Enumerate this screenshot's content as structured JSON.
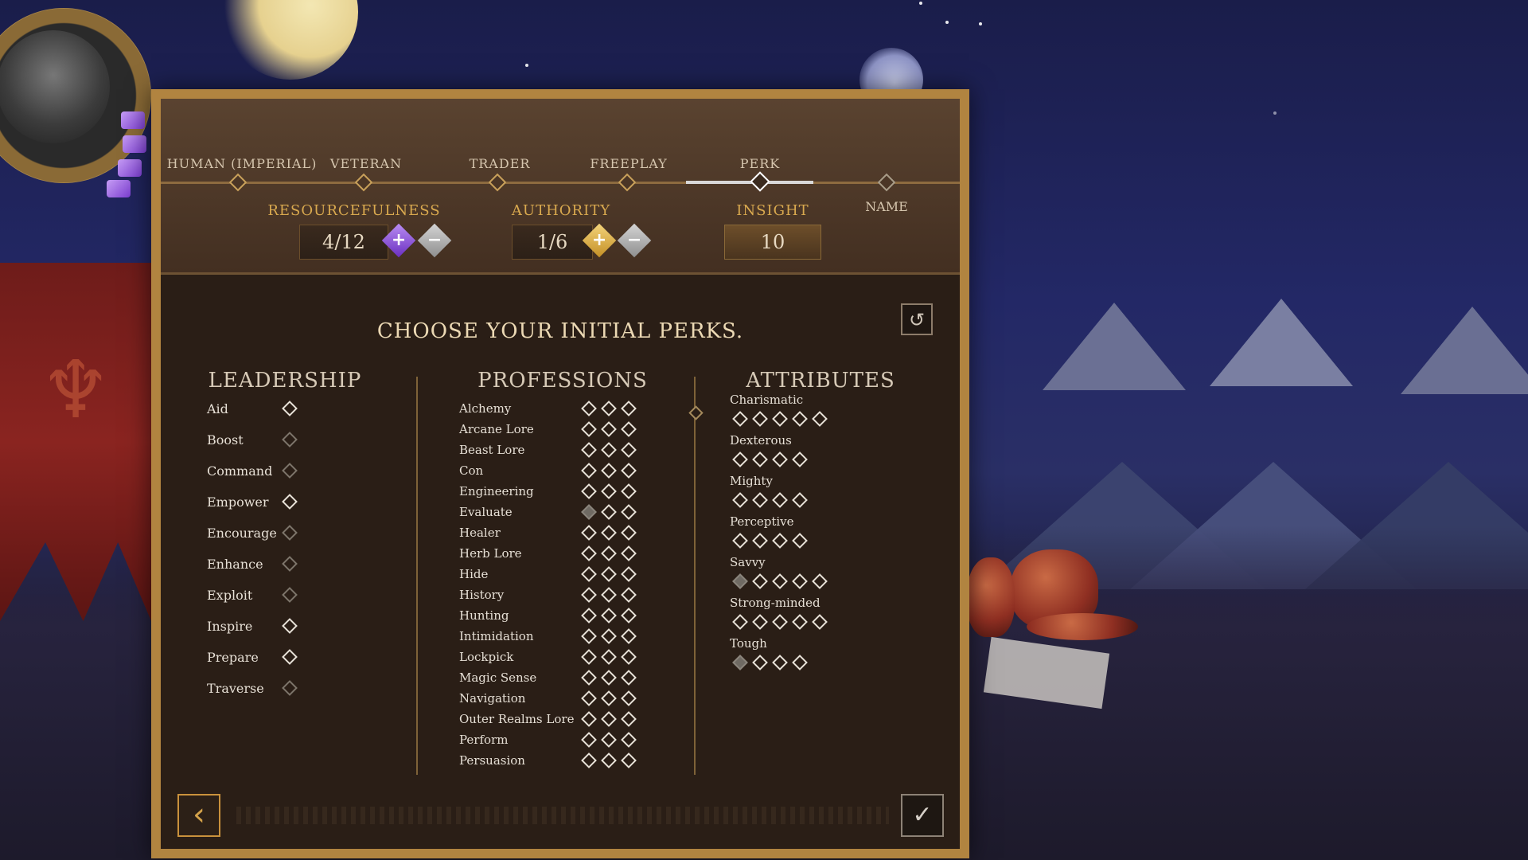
{
  "steps": [
    {
      "label": "HUMAN (IMPERIAL)",
      "state": "done"
    },
    {
      "label": "VETERAN",
      "state": "done"
    },
    {
      "label": "TRADER",
      "state": "done"
    },
    {
      "label": "FREEPLAY",
      "state": "done"
    },
    {
      "label": "PERK",
      "state": "current"
    },
    {
      "label": "NAME",
      "state": "future"
    }
  ],
  "stats": {
    "resourcefulness": {
      "label": "RESOURCEFULNESS",
      "value": "4/12"
    },
    "authority": {
      "label": "AUTHORITY",
      "value": "1/6"
    },
    "insight": {
      "label": "INSIGHT",
      "value": "10"
    }
  },
  "icons": {
    "plus": "+",
    "minus": "−",
    "reset": "↺",
    "back": "‹",
    "confirm": "✓"
  },
  "title": "CHOOSE YOUR INITIAL PERKS.",
  "columns": {
    "leadership": "LEADERSHIP",
    "professions": "PROFESSIONS",
    "attributes": "ATTRIBUTES"
  },
  "leadership": [
    {
      "name": "Aid",
      "state": "available"
    },
    {
      "name": "Boost",
      "state": "locked"
    },
    {
      "name": "Command",
      "state": "locked"
    },
    {
      "name": "Empower",
      "state": "available"
    },
    {
      "name": "Encourage",
      "state": "locked"
    },
    {
      "name": "Enhance",
      "state": "locked"
    },
    {
      "name": "Exploit",
      "state": "locked"
    },
    {
      "name": "Inspire",
      "state": "available"
    },
    {
      "name": "Prepare",
      "state": "available"
    },
    {
      "name": "Traverse",
      "state": "locked"
    }
  ],
  "professions": [
    {
      "name": "Alchemy",
      "ranks": 3,
      "filled": 0
    },
    {
      "name": "Arcane Lore",
      "ranks": 3,
      "filled": 0
    },
    {
      "name": "Beast Lore",
      "ranks": 3,
      "filled": 0
    },
    {
      "name": "Con",
      "ranks": 3,
      "filled": 0
    },
    {
      "name": "Engineering",
      "ranks": 3,
      "filled": 0
    },
    {
      "name": "Evaluate",
      "ranks": 3,
      "filled": 1
    },
    {
      "name": "Healer",
      "ranks": 3,
      "filled": 0
    },
    {
      "name": "Herb Lore",
      "ranks": 3,
      "filled": 0
    },
    {
      "name": "Hide",
      "ranks": 3,
      "filled": 0
    },
    {
      "name": "History",
      "ranks": 3,
      "filled": 0
    },
    {
      "name": "Hunting",
      "ranks": 3,
      "filled": 0
    },
    {
      "name": "Intimidation",
      "ranks": 3,
      "filled": 0
    },
    {
      "name": "Lockpick",
      "ranks": 3,
      "filled": 0
    },
    {
      "name": "Magic Sense",
      "ranks": 3,
      "filled": 0
    },
    {
      "name": "Navigation",
      "ranks": 3,
      "filled": 0
    },
    {
      "name": "Outer Realms Lore",
      "ranks": 3,
      "filled": 0
    },
    {
      "name": "Perform",
      "ranks": 3,
      "filled": 0
    },
    {
      "name": "Persuasion",
      "ranks": 3,
      "filled": 0
    }
  ],
  "attributes": [
    {
      "name": "Charismatic",
      "ranks": 5,
      "filled": 0
    },
    {
      "name": "Dexterous",
      "ranks": 4,
      "filled": 0
    },
    {
      "name": "Mighty",
      "ranks": 4,
      "filled": 0
    },
    {
      "name": "Perceptive",
      "ranks": 4,
      "filled": 0
    },
    {
      "name": "Savvy",
      "ranks": 5,
      "filled": 1
    },
    {
      "name": "Strong-minded",
      "ranks": 5,
      "filled": 0
    },
    {
      "name": "Tough",
      "ranks": 4,
      "filled": 1
    }
  ],
  "colors": {
    "accent_gold": "#d9a94f",
    "purple_button": "#7c3ed1",
    "frame": "#b18440"
  }
}
